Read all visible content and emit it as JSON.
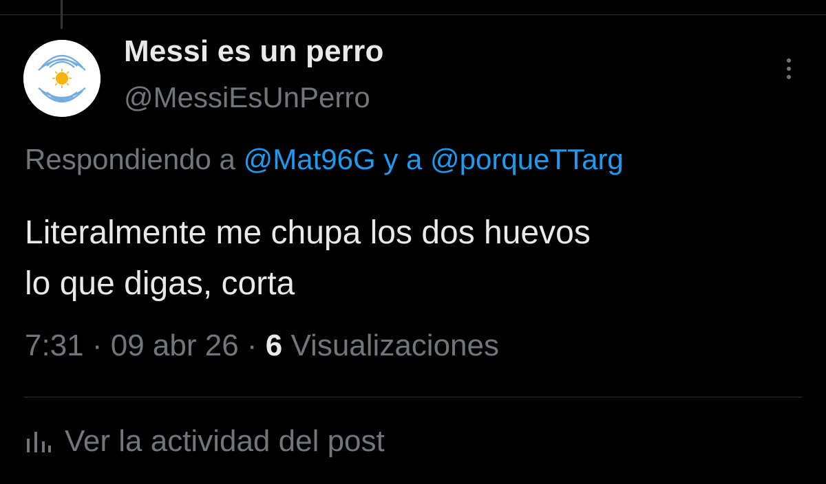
{
  "tweet": {
    "display_name": "Messi es un perro",
    "handle": "@MessiEsUnPerro",
    "replying_prefix": "Respondiendo a ",
    "reply_mention_1": "@Mat96G",
    "reply_joiner": " y a ",
    "reply_mention_2": "@porqueTTarg",
    "text_line_1": "Literalmente me chupa los dos huevos",
    "text_line_2": "lo que digas, corta",
    "time": "7:31",
    "separator": " · ",
    "date": "09 abr 26",
    "views_count": "6",
    "views_label": " Visualizaciones"
  },
  "actions": {
    "activity_label": "Ver la actividad del post"
  },
  "icons": {
    "more": "more-vertical-icon",
    "activity": "bar-chart-icon",
    "avatar": "argentina-flag-fingerprint"
  },
  "colors": {
    "background": "#000000",
    "primary_text": "#e7e9ea",
    "secondary_text": "#71767b",
    "link": "#1d9bf0",
    "divider": "#2f3336",
    "flag_blue": "#74acdf",
    "sun": "#f6b40e"
  }
}
